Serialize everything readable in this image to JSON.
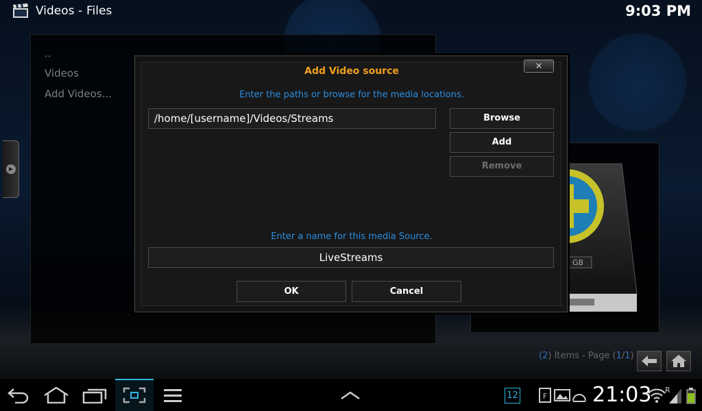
{
  "header": {
    "title": "Videos",
    "separator": "-",
    "subtitle": "Files",
    "clock": "9:03 PM",
    "app_icon": "clapperboard-icon"
  },
  "file_list": {
    "items": [
      {
        "label": ".."
      },
      {
        "label": "Videos"
      },
      {
        "label": "Add Videos..."
      }
    ]
  },
  "preview": {
    "drive_label": "GB",
    "icon": "hard-drive-plus-icon"
  },
  "pagination": {
    "open_paren": "(",
    "count": "2",
    "items_text": ") Items - Page (",
    "page": "1",
    "slash": "/",
    "total": "1",
    "close_paren": ")",
    "back_icon": "back-arrow-icon",
    "home_icon": "home-icon"
  },
  "dialog": {
    "title": "Add Video source",
    "close_label": "×",
    "paths_hint": "Enter the paths or browse for the media locations.",
    "path_value": "/home/[username]/Videos/Streams",
    "browse_label": "Browse",
    "add_label": "Add",
    "remove_label": "Remove",
    "name_hint": "Enter a name for this media Source.",
    "name_value": "LiveStreams",
    "ok_label": "OK",
    "cancel_label": "Cancel"
  },
  "system_bar": {
    "back_icon": "back-icon",
    "home_icon": "home-icon",
    "recents_icon": "recent-apps-icon",
    "screenshot_icon": "screenshot-icon",
    "menu_icon": "menu-icon",
    "up_icon": "chevron-up-icon",
    "notification_count": "12",
    "clock": "21:03",
    "roaming": "R",
    "accent": "#33b5e5"
  }
}
